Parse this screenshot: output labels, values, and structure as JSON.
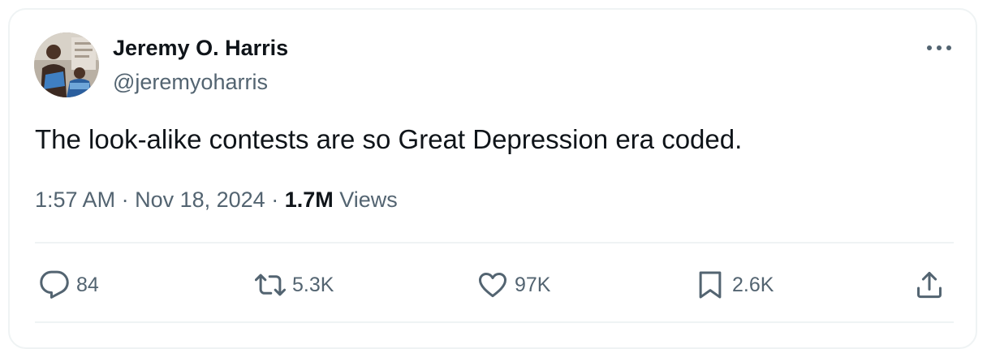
{
  "tweet": {
    "author_name": "Jeremy O. Harris",
    "handle": "@jeremyoharris",
    "text": "The look-alike contests are so Great Depression era coded.",
    "time": "1:57 AM",
    "date": "Nov 18, 2024",
    "separator": "·",
    "views_count": "1.7M",
    "views_label": "Views"
  },
  "actions": {
    "replies": "84",
    "retweets": "5.3K",
    "likes": "97K",
    "bookmarks": "2.6K"
  },
  "icons": {
    "more": "more-horizontal-icon",
    "reply": "reply-icon",
    "retweet": "retweet-icon",
    "like": "heart-icon",
    "bookmark": "bookmark-icon",
    "share": "share-icon"
  },
  "colors": {
    "text_primary": "#0f1419",
    "text_secondary": "#536471",
    "border": "#eff3f4"
  }
}
